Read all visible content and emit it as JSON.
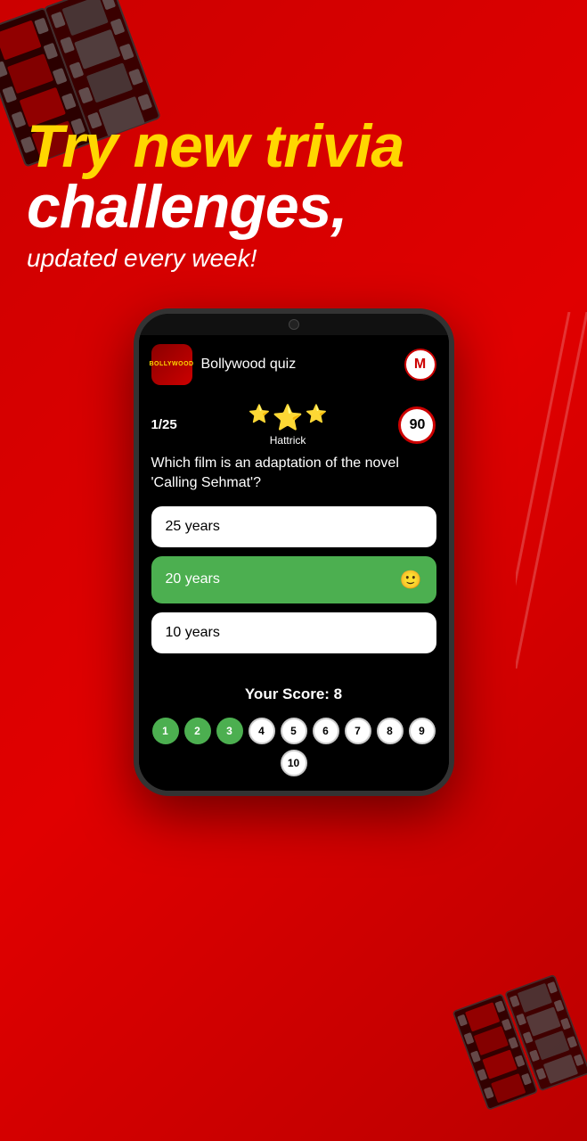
{
  "background": {
    "color": "#cc0000"
  },
  "headline": {
    "line1": "Try new trivia",
    "line2": "challenges,",
    "subline": "updated every week!"
  },
  "app": {
    "icon_text": "BOLLYWOOD",
    "title": "Bollywood quiz",
    "user_initial": "M"
  },
  "quiz": {
    "question_number": "1/25",
    "stars": [
      "⭐",
      "⭐",
      "⭐"
    ],
    "hattrick_label": "Hattrick",
    "timer_value": "90",
    "question_text": "Which film is an adaptation of the novel 'Calling Sehmat'?",
    "answers": [
      {
        "text": "25 years",
        "state": "default",
        "emoji": ""
      },
      {
        "text": "20 years",
        "state": "correct",
        "emoji": "🙂"
      },
      {
        "text": "10 years",
        "state": "default",
        "emoji": ""
      }
    ]
  },
  "score": {
    "label": "Your Score: 8"
  },
  "progress": {
    "dots": [
      {
        "number": "1",
        "state": "green"
      },
      {
        "number": "2",
        "state": "green"
      },
      {
        "number": "3",
        "state": "green"
      },
      {
        "number": "4",
        "state": "white"
      },
      {
        "number": "5",
        "state": "white"
      },
      {
        "number": "6",
        "state": "white"
      },
      {
        "number": "7",
        "state": "white"
      },
      {
        "number": "8",
        "state": "white"
      },
      {
        "number": "9",
        "state": "white"
      },
      {
        "number": "10",
        "state": "white"
      }
    ]
  }
}
